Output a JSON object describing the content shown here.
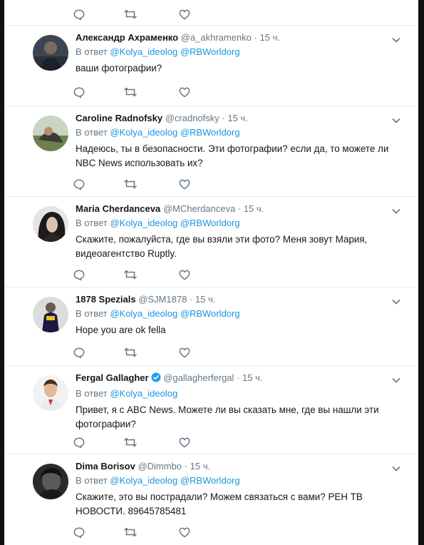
{
  "reply_prefix": "В ответ",
  "colors": {
    "link": "#1b95e0",
    "secondary": "#657786",
    "verified": "#1da1f2",
    "text": "#14171a"
  },
  "icons": {
    "reply": "reply-icon",
    "retweet": "retweet-icon",
    "like": "like-icon",
    "more": "chevron-down-icon"
  },
  "tweets": [
    {
      "name": "Александр Ахраменко",
      "handle": "@a_akhramenko",
      "time": "15 ч.",
      "verified": false,
      "mention1": "@Kolya_ideolog",
      "mention2": "@RBWorldorg",
      "text": "ваши фотографии?"
    },
    {
      "name": "Caroline Radnofsky",
      "handle": "@cradnofsky",
      "time": "15 ч.",
      "verified": false,
      "mention1": "@Kolya_ideolog",
      "mention2": "@RBWorldorg",
      "text": "Надеюсь, ты в безопасности. Эти фотографии? если да, то можете ли NBC News использовать их?"
    },
    {
      "name": "Maria Cherdanceva",
      "handle": "@MCherdanceva",
      "time": "15 ч.",
      "verified": false,
      "mention1": "@Kolya_ideolog",
      "mention2": "@RBWorldorg",
      "text": "Скажите, пожалуйста, где вы взяли эти фото? Меня зовут Мария, видеоагентство Ruptly."
    },
    {
      "name": "1878 Spezials",
      "handle": "@SJM1878",
      "time": "15 ч.",
      "verified": false,
      "mention1": "@Kolya_ideolog",
      "mention2": "@RBWorldorg",
      "text": "Hope you are ok fella"
    },
    {
      "name": "Fergal Gallagher",
      "handle": "@gallagherfergal",
      "time": "15 ч.",
      "verified": true,
      "mention1": "@Kolya_ideolog",
      "mention2": "",
      "text": "Привет, я с ABC News. Можете ли вы сказать мне, где вы нашли эти фотографии?"
    },
    {
      "name": "Dima Borisov",
      "handle": "@Dimmbo",
      "time": "15 ч.",
      "verified": false,
      "mention1": "@Kolya_ideolog",
      "mention2": "@RBWorldorg",
      "text": "Скажите, это вы пострадали? Можем связаться с вами? РЕН ТВ НОВОСТИ. 89645785481"
    }
  ]
}
